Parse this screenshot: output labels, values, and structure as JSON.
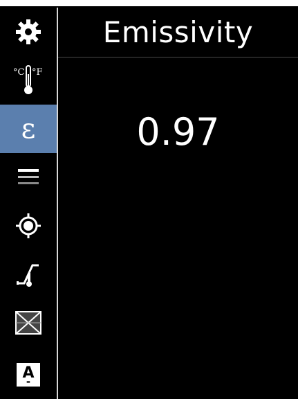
{
  "header": {
    "title": "Emissivity"
  },
  "main": {
    "value": "0.97"
  },
  "sidebar": {
    "items": [
      {
        "icon": "gear-icon",
        "label": ""
      },
      {
        "icon": "thermometer-units-icon",
        "label_c": "°C",
        "label_f": "°F"
      },
      {
        "icon": "epsilon-icon",
        "glyph": "ε",
        "active": true
      },
      {
        "icon": "lines-icon"
      },
      {
        "icon": "crosshair-icon"
      },
      {
        "icon": "curve-icon"
      },
      {
        "icon": "image-cross-icon"
      },
      {
        "icon": "letter-a-icon",
        "glyph": "A"
      }
    ]
  },
  "colors": {
    "background": "#000000",
    "active_item": "#5b7fae",
    "text": "#ffffff",
    "divider": "#d8d8d8"
  }
}
